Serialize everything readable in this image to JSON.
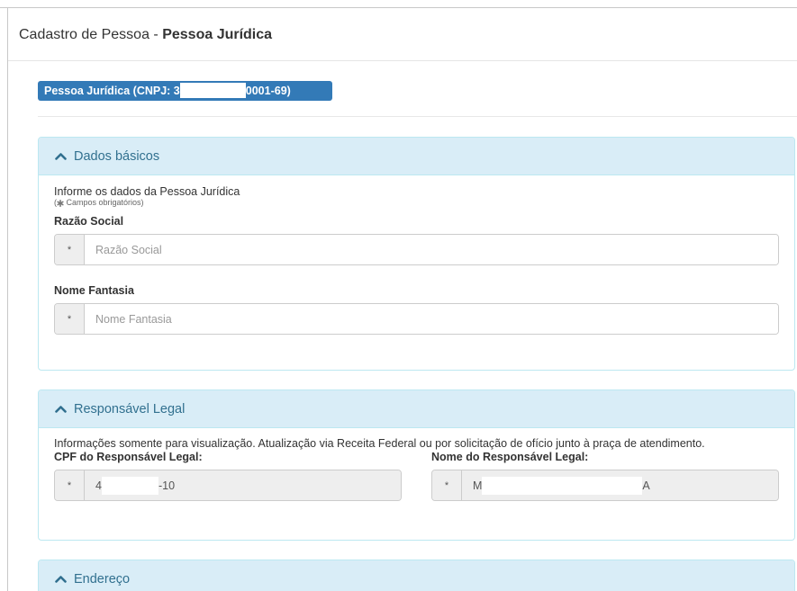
{
  "page": {
    "title_prefix": "Cadastro de Pessoa - ",
    "title_bold": "Pessoa Jurídica"
  },
  "badge": {
    "prefix": "Pessoa Jurídica (CNPJ: 3",
    "suffix": "0001-69)"
  },
  "panels": {
    "dados_basicos": {
      "title": "Dados básicos",
      "description": "Informe os dados da Pessoa Jurídica",
      "required_note": "Campos obrigatórios)",
      "required_note_open": "(",
      "fields": {
        "razao_social": {
          "label": "Razão Social",
          "placeholder": "Razão Social",
          "addon": "*"
        },
        "nome_fantasia": {
          "label": "Nome Fantasia",
          "placeholder": "Nome Fantasia",
          "addon": "*"
        }
      }
    },
    "responsavel_legal": {
      "title": "Responsável Legal",
      "description": "Informações somente para visualização. Atualização via Receita Federal ou por solicitação de ofício junto à praça de atendimento.",
      "fields": {
        "cpf": {
          "label": "CPF do Responsável Legal:",
          "addon": "*",
          "value_start": "4",
          "value_end": "-10"
        },
        "nome": {
          "label": "Nome do Responsável Legal:",
          "addon": "*",
          "value_start": "M",
          "value_end": "A"
        }
      }
    },
    "endereco": {
      "title": "Endereço"
    }
  },
  "colors": {
    "badge_bg": "#337ab7",
    "panel_heading_bg": "#d9edf7",
    "panel_heading_text": "#31708f",
    "panel_border": "#bce8f1"
  },
  "icons": {
    "panel_toggle": "chevron-up-icon",
    "required_marker": "asterisk-icon"
  }
}
